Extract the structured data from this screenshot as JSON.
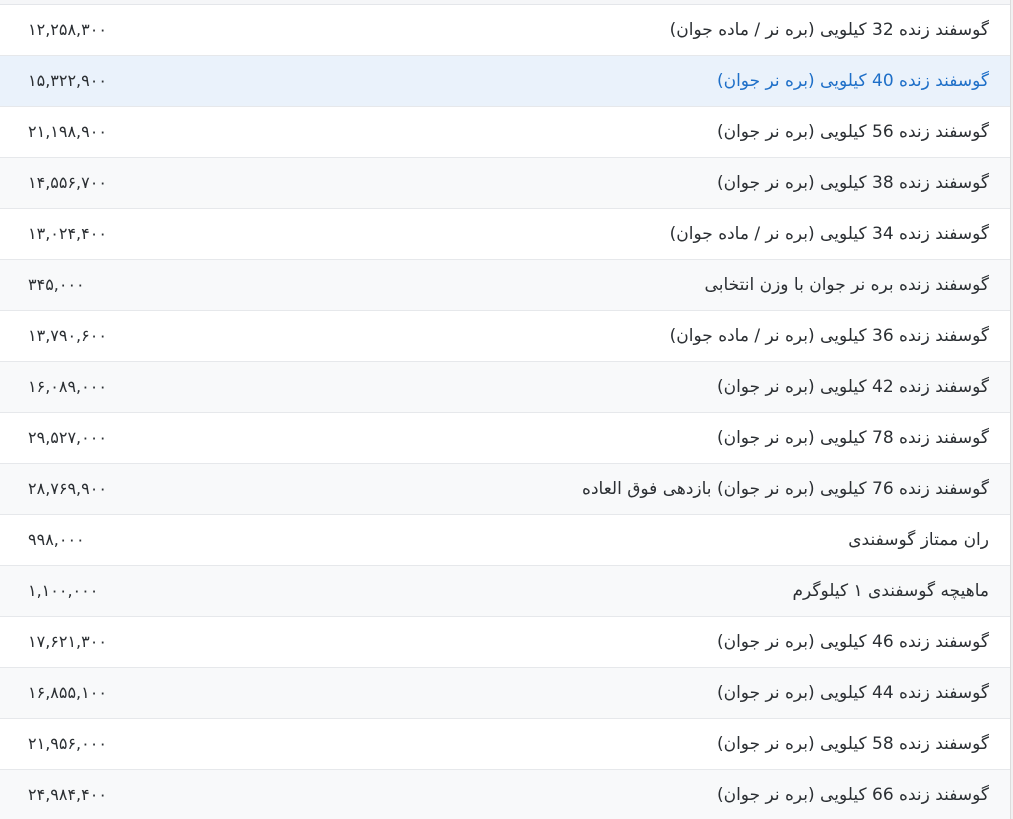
{
  "rows": [
    {
      "name": "گوسفند زنده 32 کیلویی (بره نر / ماده جوان)",
      "price": "۱۲,۲۵۸,۳۰۰"
    },
    {
      "name": "گوسفند زنده 40 کیلویی (بره نر جوان)",
      "price": "۱۵,۳۲۲,۹۰۰"
    },
    {
      "name": "گوسفند زنده 56 کیلویی (بره نر جوان)",
      "price": "۲۱,۱۹۸,۹۰۰"
    },
    {
      "name": "گوسفند زنده 38 کیلویی (بره نر جوان)",
      "price": "۱۴,۵۵۶,۷۰۰"
    },
    {
      "name": "گوسفند زنده 34 کیلویی (بره نر / ماده جوان)",
      "price": "۱۳,۰۲۴,۴۰۰"
    },
    {
      "name": "گوسفند زنده بره نر جوان با وزن انتخابی",
      "price": "۳۴۵,۰۰۰"
    },
    {
      "name": "گوسفند زنده 36 کیلویی (بره نر / ماده جوان)",
      "price": "۱۳,۷۹۰,۶۰۰"
    },
    {
      "name": "گوسفند زنده 42 کیلویی (بره نر جوان)",
      "price": "۱۶,۰۸۹,۰۰۰"
    },
    {
      "name": "گوسفند زنده 78 کیلویی (بره نر جوان)",
      "price": "۲۹,۵۲۷,۰۰۰"
    },
    {
      "name": "گوسفند زنده 76 کیلویی (بره نر جوان) بازدهی فوق العاده",
      "price": "۲۸,۷۶۹,۹۰۰"
    },
    {
      "name": "ران ممتاز گوسفندی",
      "price": "۹۹۸,۰۰۰"
    },
    {
      "name": "ماهیچه گوسفندی ۱ کیلوگرم",
      "price": "۱,۱۰۰,۰۰۰"
    },
    {
      "name": "گوسفند زنده 46 کیلویی (بره نر جوان)",
      "price": "۱۷,۶۲۱,۳۰۰"
    },
    {
      "name": "گوسفند زنده 44 کیلویی (بره نر جوان)",
      "price": "۱۶,۸۵۵,۱۰۰"
    },
    {
      "name": "گوسفند زنده 58 کیلویی (بره نر جوان)",
      "price": "۲۱,۹۵۶,۰۰۰"
    },
    {
      "name": "گوسفند زنده 66 کیلویی (بره نر جوان)",
      "price": "۲۴,۹۸۴,۴۰۰"
    }
  ],
  "colors": {
    "highlight_background": "#eaf2fb",
    "highlight_text": "#1e6fc8",
    "text": "#2b2f33",
    "row_divider": "#e6e8eb"
  }
}
